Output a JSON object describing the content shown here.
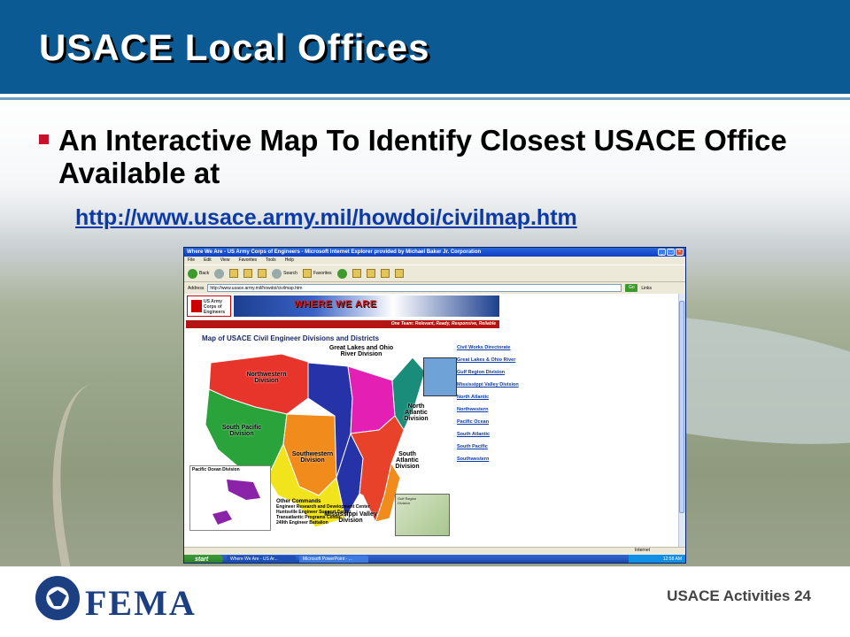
{
  "slide": {
    "title": "USACE Local Offices",
    "bullet": "An Interactive Map To Identify Closest USACE Office Available at",
    "link": "http://www.usace.army.mil/howdoi/civilmap.htm",
    "footer_label": "USACE Activities 24",
    "logo_text": "FEMA"
  },
  "browser": {
    "window_title": "Where We Are - US Army Corps of Engineers - Microsoft Internet Explorer provided by Michael Baker Jr. Corporation",
    "menu": [
      "File",
      "Edit",
      "View",
      "Favorites",
      "Tools",
      "Help"
    ],
    "toolbar": {
      "back": "Back",
      "search": "Search",
      "favorites": "Favorites"
    },
    "address_label": "Address",
    "address_value": "http://www.usace.army.mil/howdoi/civilmap.htm",
    "go_label": "Go",
    "links_label": "Links",
    "status_zone": "Internet",
    "taskbar": {
      "start": "start",
      "items": [
        "Where We Are - US Ar...",
        "Microsoft PowerPoint - ..."
      ],
      "clock": "12:58 AM"
    }
  },
  "page": {
    "logo_text": "US Army Corps of Engineers",
    "banner": "WHERE WE ARE",
    "tagline": "One Team: Relevant, Ready, Responsive, Reliable",
    "map_heading": "Map of USACE Civil Engineer Divisions and Districts",
    "divisions": {
      "northwestern": "Northwestern Division",
      "south_pacific": "South Pacific Division",
      "great_lakes": "Great Lakes and Ohio River Division",
      "north_atlantic": "North Atlantic Division",
      "southwestern": "Southwestern Division",
      "south_atlantic": "South Atlantic Division",
      "mississippi": "Mississippi Valley Division",
      "pacific_ocean": "Pacific Ocean Division"
    },
    "other_commands_header": "Other Commands",
    "other_commands": [
      "Engineer Research and Development Center",
      "Huntsville Engineer Support Center",
      "Transatlantic Programs Center",
      "249th Engineer Battalion"
    ],
    "gulf_inset_label": "Gulf Region Division",
    "side_links": [
      "Civil Works Directorate",
      "Great Lakes & Ohio River",
      "Gulf Region Division",
      "Mississippi Valley Division",
      "North Atlantic",
      "Northwestern",
      "Pacific Ocean",
      "South Atlantic",
      "South Pacific",
      "Southwestern"
    ]
  },
  "colors": {
    "title_bar": "#0b5a93",
    "bullet_marker": "#c8102e",
    "link": "#0b3aa8",
    "northwestern": "#e8352c",
    "south_pacific": "#2aa33a",
    "great_lakes": "#2532a8",
    "north_atlantic": "#1a8c7a",
    "southwestern": "#f08b1c",
    "south_atlantic": "#e8422a",
    "mississippi": "#f1e31c",
    "lakes_magenta": "#e31fb4"
  }
}
